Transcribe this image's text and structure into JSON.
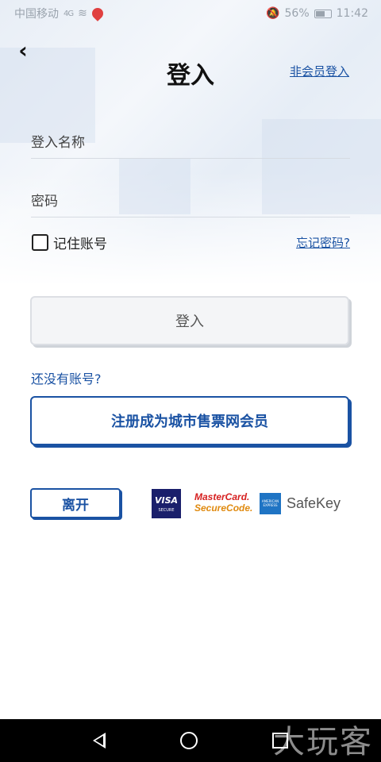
{
  "status_bar": {
    "carrier": "中国移动",
    "signal": "4G",
    "battery": "56%",
    "time": "11:42"
  },
  "header": {
    "title": "登入",
    "guest_login": "非会员登入"
  },
  "form": {
    "username_placeholder": "登入名称",
    "password_placeholder": "密码",
    "remember_label": "记住账号",
    "forgot_link": "忘记密码?"
  },
  "actions": {
    "login_button": "登入",
    "no_account": "还没有账号?",
    "register_button": "注册成为城市售票网会员",
    "leave_button": "离开"
  },
  "payment_logos": {
    "visa_line1": "VISA",
    "visa_line2": "SECURE",
    "mc_line1": "MasterCard.",
    "mc_line2": "SecureCode.",
    "amex_text": "AMERICAN EXPRESS",
    "safekey": "SafeKey"
  },
  "watermark": "大玩客",
  "colors": {
    "accent": "#1a52a3",
    "visa": "#1a1f6b",
    "mastercard_red": "#d62020",
    "mastercard_orange": "#e08a10",
    "amex": "#1f74c4"
  },
  "icons": {
    "back": "chevron-left-icon",
    "nav_back": "triangle-back-icon",
    "nav_home": "circle-home-icon",
    "nav_recent": "square-recent-icon"
  }
}
